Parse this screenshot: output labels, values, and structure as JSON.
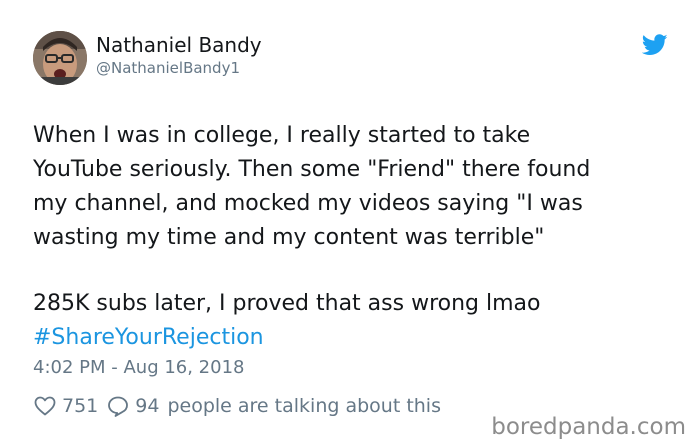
{
  "author": {
    "name": "Nathaniel Bandy",
    "handle": "@NathanielBandy1"
  },
  "tweet": {
    "lines": [
      "When I was in college, I really started to take",
      "YouTube seriously. Then some \"Friend\" there found",
      "my channel, and mocked my videos saying \"I was",
      "wasting my time and my content was terrible\"",
      "285K subs later, I proved that ass wrong lmao"
    ],
    "hashtag": "#ShareYourRejection"
  },
  "timestamp": "4:02 PM - Aug 16, 2018",
  "actions": {
    "likes": "751",
    "replies": "94",
    "talking_text": "people are talking about this"
  },
  "watermark": "boredpanda.com",
  "icons": {
    "brand": "twitter-bird-icon",
    "like": "heart-icon",
    "reply": "speech-bubble-icon"
  },
  "colors": {
    "text": "#14171a",
    "muted": "#657786",
    "link": "#1b95e0",
    "twitter_blue": "#1da1f2",
    "watermark": "#8c8c8c"
  }
}
